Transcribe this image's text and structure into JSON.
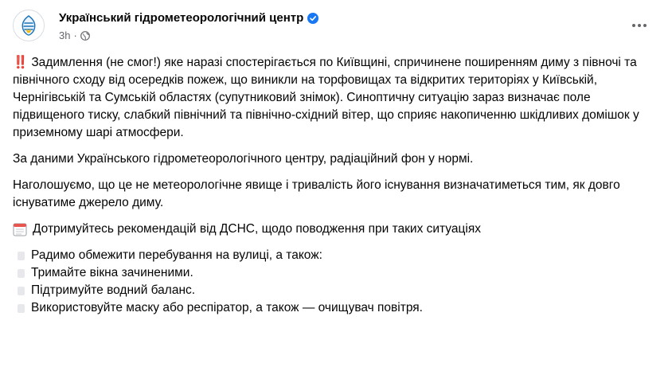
{
  "post": {
    "page_name": "Український гідрометеорологічний центр",
    "time": "3h",
    "separator": "·",
    "paragraphs": {
      "p1_marker": "‼️",
      "p1": "Задимлення (не смог!) яке наразі спостерігається по Київщині, спричинене поширенням диму з півночі та північного сходу від осередків пожеж, що виникли на торфовищах та відкритих територіях у Київській, Чернігівській та Сумській областях (супутниковий знімок). Синоптичну ситуацію зараз визначає поле підвищеного тиску, слабкий північний та північно-східний вітер, що сприяє накопиченню шкідливих домішок у приземному шарі атмосфери.",
      "p2": "За даними Українського гідрометеорологічного центру, радіаційний фон у нормі.",
      "p3": "Наголошуємо, що це не метеорологічне явище  і тривалість його існування визначатиметься тим, як довго існуватиме джерело диму.",
      "p4": "Дотримуйтесь рекомендацій від ДСНС, щодо поводження при таких ситуаціях"
    },
    "bullets": [
      "Радимо обмежити перебування на вулиці, а також:",
      "Тримайте вікна зачиненими.",
      "Підтримуйте водний баланс.",
      "Використовуйте маску або респіратор, а також — очищувач повітря."
    ]
  },
  "colors": {
    "verified": "#1877f2",
    "secondary_text": "#65676b",
    "alert": "#e0245e"
  },
  "icons": [
    "avatar-logo",
    "verified-badge-icon",
    "globe-icon",
    "more-options-icon",
    "calendar-icon",
    "bullet-icon"
  ]
}
